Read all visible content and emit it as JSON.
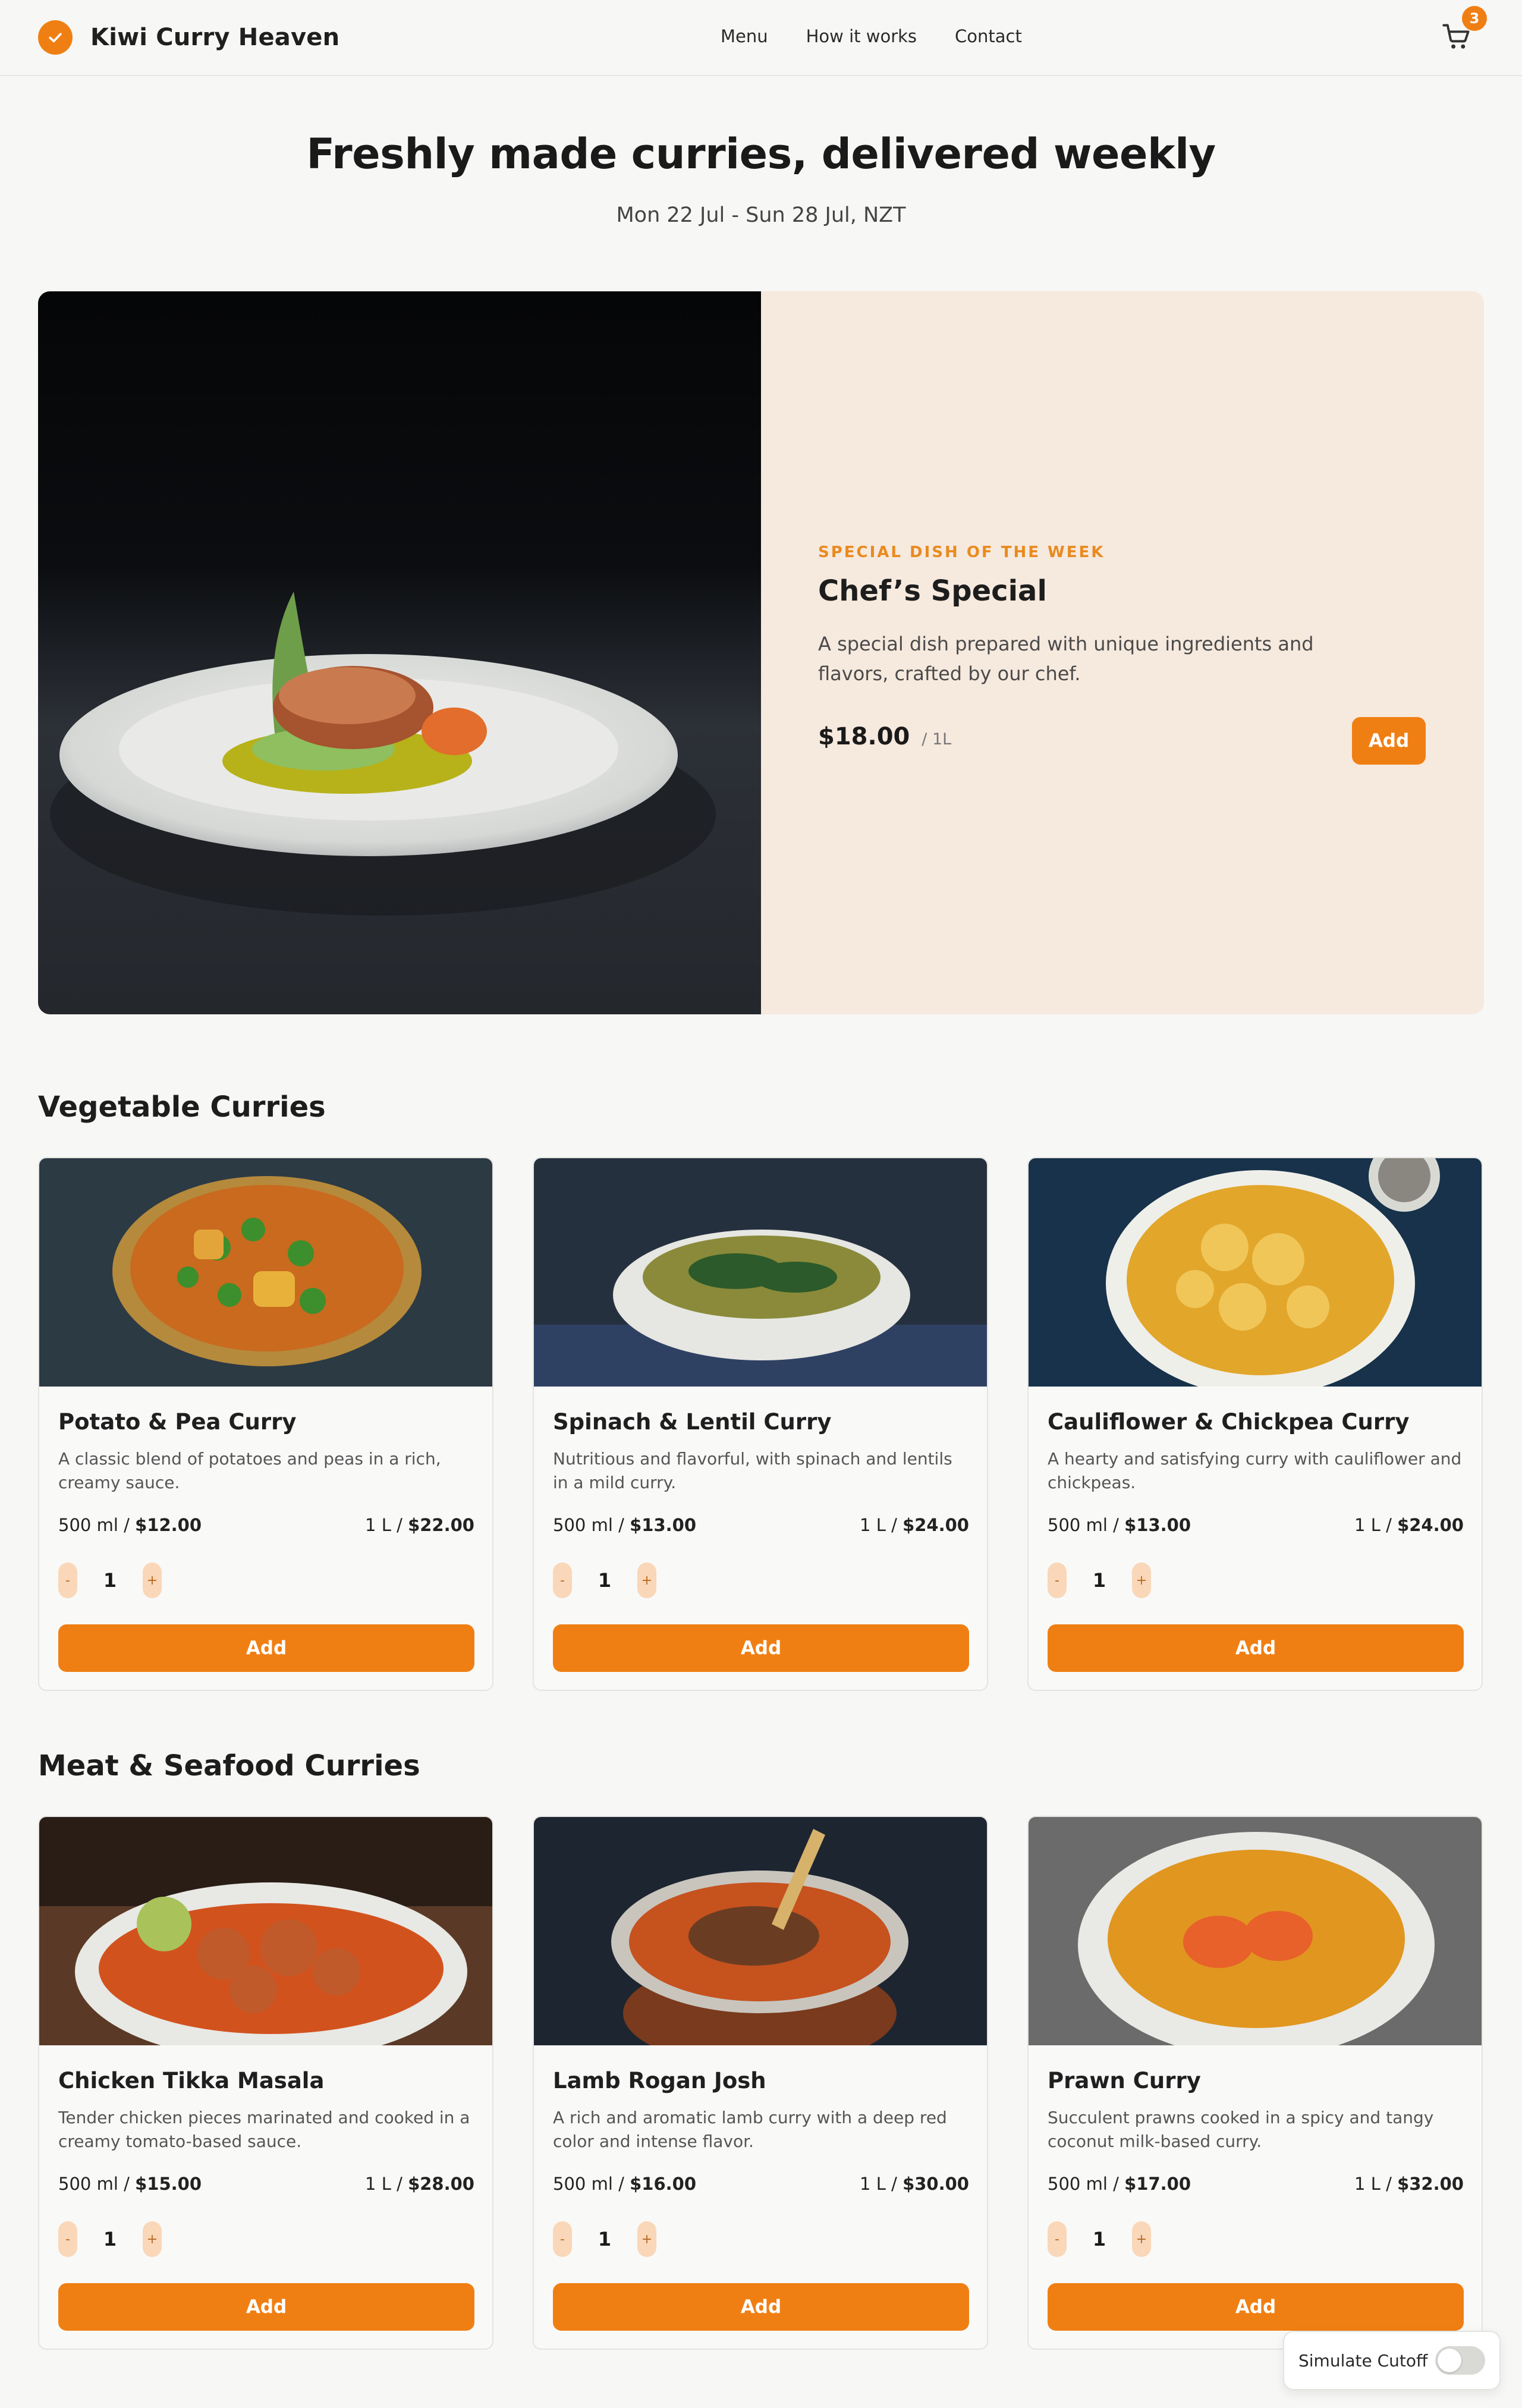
{
  "header": {
    "brand": "Kiwi Curry Heaven",
    "nav": [
      "Menu",
      "How it works",
      "Contact"
    ],
    "cart_count": "3"
  },
  "hero": {
    "title": "Freshly made curries, delivered weekly",
    "subtitle": "Mon 22 Jul - Sun 28 Jul, NZT"
  },
  "special": {
    "kicker": "SPECIAL DISH OF THE WEEK",
    "title": "Chef’s Special",
    "description": "A special dish prepared with unique ingredients and flavors, crafted by our chef.",
    "price": "$18.00",
    "unit": "/ 1L",
    "add_label": "Add"
  },
  "vegetable": {
    "title": "Vegetable Curries",
    "items": [
      {
        "name": "Potato & Pea Curry",
        "desc": "A classic blend of potatoes and peas in a rich, creamy sauce.",
        "small_size": "500 ml /",
        "small_price": "$12.00",
        "large_size": "1 L /",
        "large_price": "$22.00",
        "qty": "1",
        "add": "Add"
      },
      {
        "name": "Spinach & Lentil Curry",
        "desc": "Nutritious and flavorful, with spinach and lentils in a mild curry.",
        "small_size": "500 ml /",
        "small_price": "$13.00",
        "large_size": "1 L /",
        "large_price": "$24.00",
        "qty": "1",
        "add": "Add"
      },
      {
        "name": "Cauliflower & Chickpea Curry",
        "desc": "A hearty and satisfying curry with cauliflower and chickpeas.",
        "small_size": "500 ml /",
        "small_price": "$13.00",
        "large_size": "1 L /",
        "large_price": "$24.00",
        "qty": "1",
        "add": "Add"
      }
    ]
  },
  "meat": {
    "title": "Meat & Seafood Curries",
    "items": [
      {
        "name": "Chicken Tikka Masala",
        "desc": "Tender chicken pieces marinated and cooked in a creamy tomato-based sauce.",
        "small_size": "500 ml /",
        "small_price": "$15.00",
        "large_size": "1 L /",
        "large_price": "$28.00",
        "qty": "1",
        "add": "Add"
      },
      {
        "name": "Lamb Rogan Josh",
        "desc": "A rich and aromatic lamb curry with a deep red color and intense flavor.",
        "small_size": "500 ml /",
        "small_price": "$16.00",
        "large_size": "1 L /",
        "large_price": "$30.00",
        "qty": "1",
        "add": "Add"
      },
      {
        "name": "Prawn Curry",
        "desc": "Succulent prawns cooked in a spicy and tangy coconut milk-based curry.",
        "small_size": "500 ml /",
        "small_price": "$17.00",
        "large_size": "1 L /",
        "large_price": "$32.00",
        "qty": "1",
        "add": "Add"
      }
    ]
  },
  "qty_controls": {
    "minus": "-",
    "plus": "+"
  },
  "simulate": {
    "label": "Simulate Cutoff",
    "enabled": false
  },
  "colors": {
    "accent": "#f07f13",
    "special_bg": "#f6e9de",
    "page_bg": "#f7f7f5"
  },
  "icons": {
    "logo": "check-circle-icon",
    "cart": "shopping-cart-icon"
  }
}
